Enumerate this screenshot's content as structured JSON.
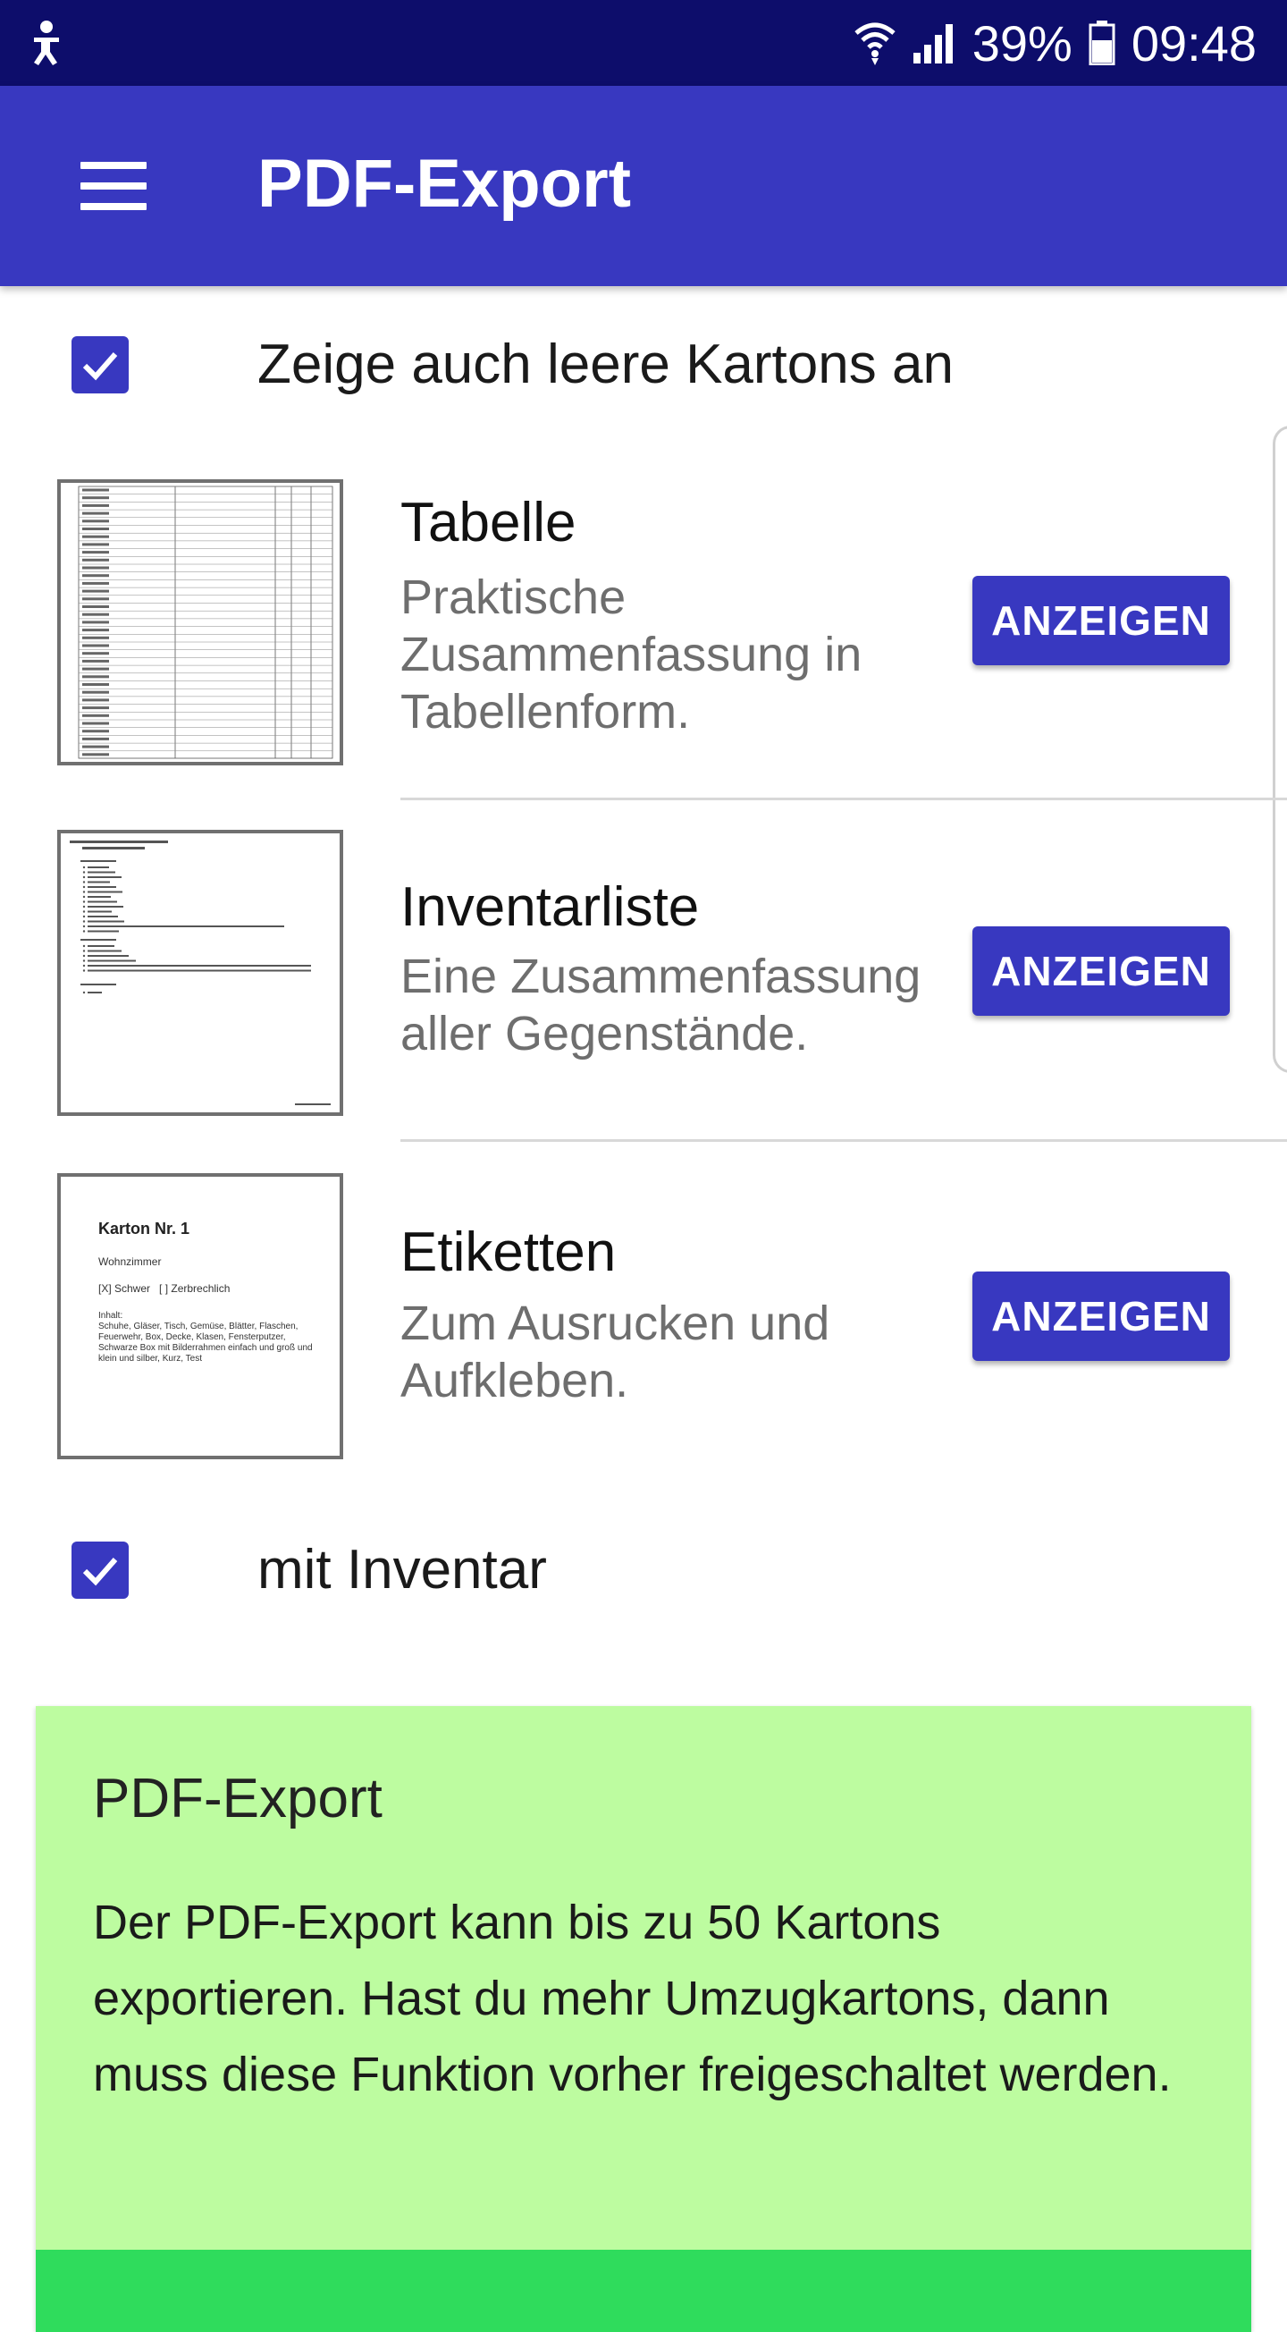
{
  "status_bar": {
    "battery_percent": "39%",
    "time": "09:48",
    "icons": [
      "accessibility-icon",
      "wifi-icon",
      "signal-icon",
      "battery-icon"
    ]
  },
  "app_bar": {
    "title": "PDF-Export",
    "menu_icon": "menu-icon"
  },
  "options": {
    "show_empty_label": "Zeige auch leere Kartons an",
    "show_empty_checked": true,
    "with_inventory_label": "mit Inventar",
    "with_inventory_checked": true
  },
  "exports": [
    {
      "title": "Tabelle",
      "description": "Praktische Zusammenfassung in Tabellenform.",
      "button": "ANZEIGEN"
    },
    {
      "title": "Inventarliste",
      "description": "Eine Zusammenfassung aller Gegenstände.",
      "button": "ANZEIGEN"
    },
    {
      "title": "Etiketten",
      "description": "Zum Ausrucken und Aufkleben.",
      "button": "ANZEIGEN"
    }
  ],
  "label_preview": {
    "title": "Karton Nr. 1",
    "room": "Wohnzimmer",
    "flags": "[X] Schwer   [ ] Zerbrechlich",
    "contents_label": "Inhalt:",
    "contents": "Schuhe, Gläser, Tisch, Gemüse, Blätter, Flaschen, Feuerwehr, Box, Decke, Klasen, Fensterputzer, Schwarze Box mit Bilderrahmen einfach und groß und klein und silber, Kurz, Test"
  },
  "info_card": {
    "title": "PDF-Export",
    "text": "Der PDF-Export kann bis zu 50 Kartons exportieren. Hast du mehr Umzugkartons, dann muss diese Funktion vorher freigeschaltet werden."
  },
  "colors": {
    "status_bar": "#0d0d6b",
    "primary": "#3838c0",
    "info_card_bg": "#bdfca0",
    "info_card_footer": "#2fdc5c"
  }
}
